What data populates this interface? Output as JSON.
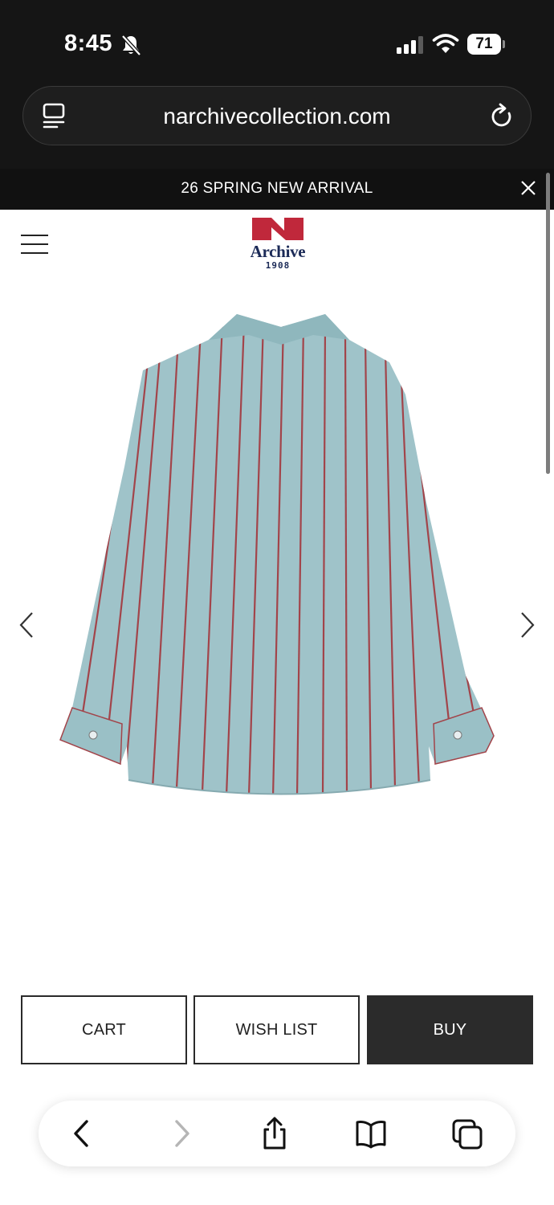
{
  "status_bar": {
    "time": "8:45",
    "battery_level": "71",
    "icons": [
      "bell-off-icon",
      "signal-icon",
      "wifi-icon",
      "battery-icon"
    ]
  },
  "browser": {
    "url": "narchivecollection.com",
    "icons": [
      "reader-icon",
      "reload-icon"
    ]
  },
  "announcement": {
    "text": "26 SPRING NEW ARRIVAL",
    "close_icon": "close-icon"
  },
  "header": {
    "logo_word": "Archive",
    "logo_year": "1908",
    "menu_icon": "hamburger-menu-icon",
    "brand_color": "#c0283b",
    "logo_text_color": "#1b2a57"
  },
  "gallery": {
    "image_subject": "light blue shirt with red vertical stripes, back view",
    "prev_icon": "chevron-left-icon",
    "next_icon": "chevron-right-icon",
    "shirt_color": "#9fc3c9",
    "stripe_color": "#a2444a"
  },
  "actions": {
    "cart_label": "CART",
    "wishlist_label": "WISH LIST",
    "buy_label": "BUY",
    "buy_bg": "#2b2b2b"
  },
  "toolbar": {
    "items": [
      "back-icon",
      "forward-icon",
      "share-icon",
      "bookmarks-icon",
      "tabs-icon"
    ]
  }
}
